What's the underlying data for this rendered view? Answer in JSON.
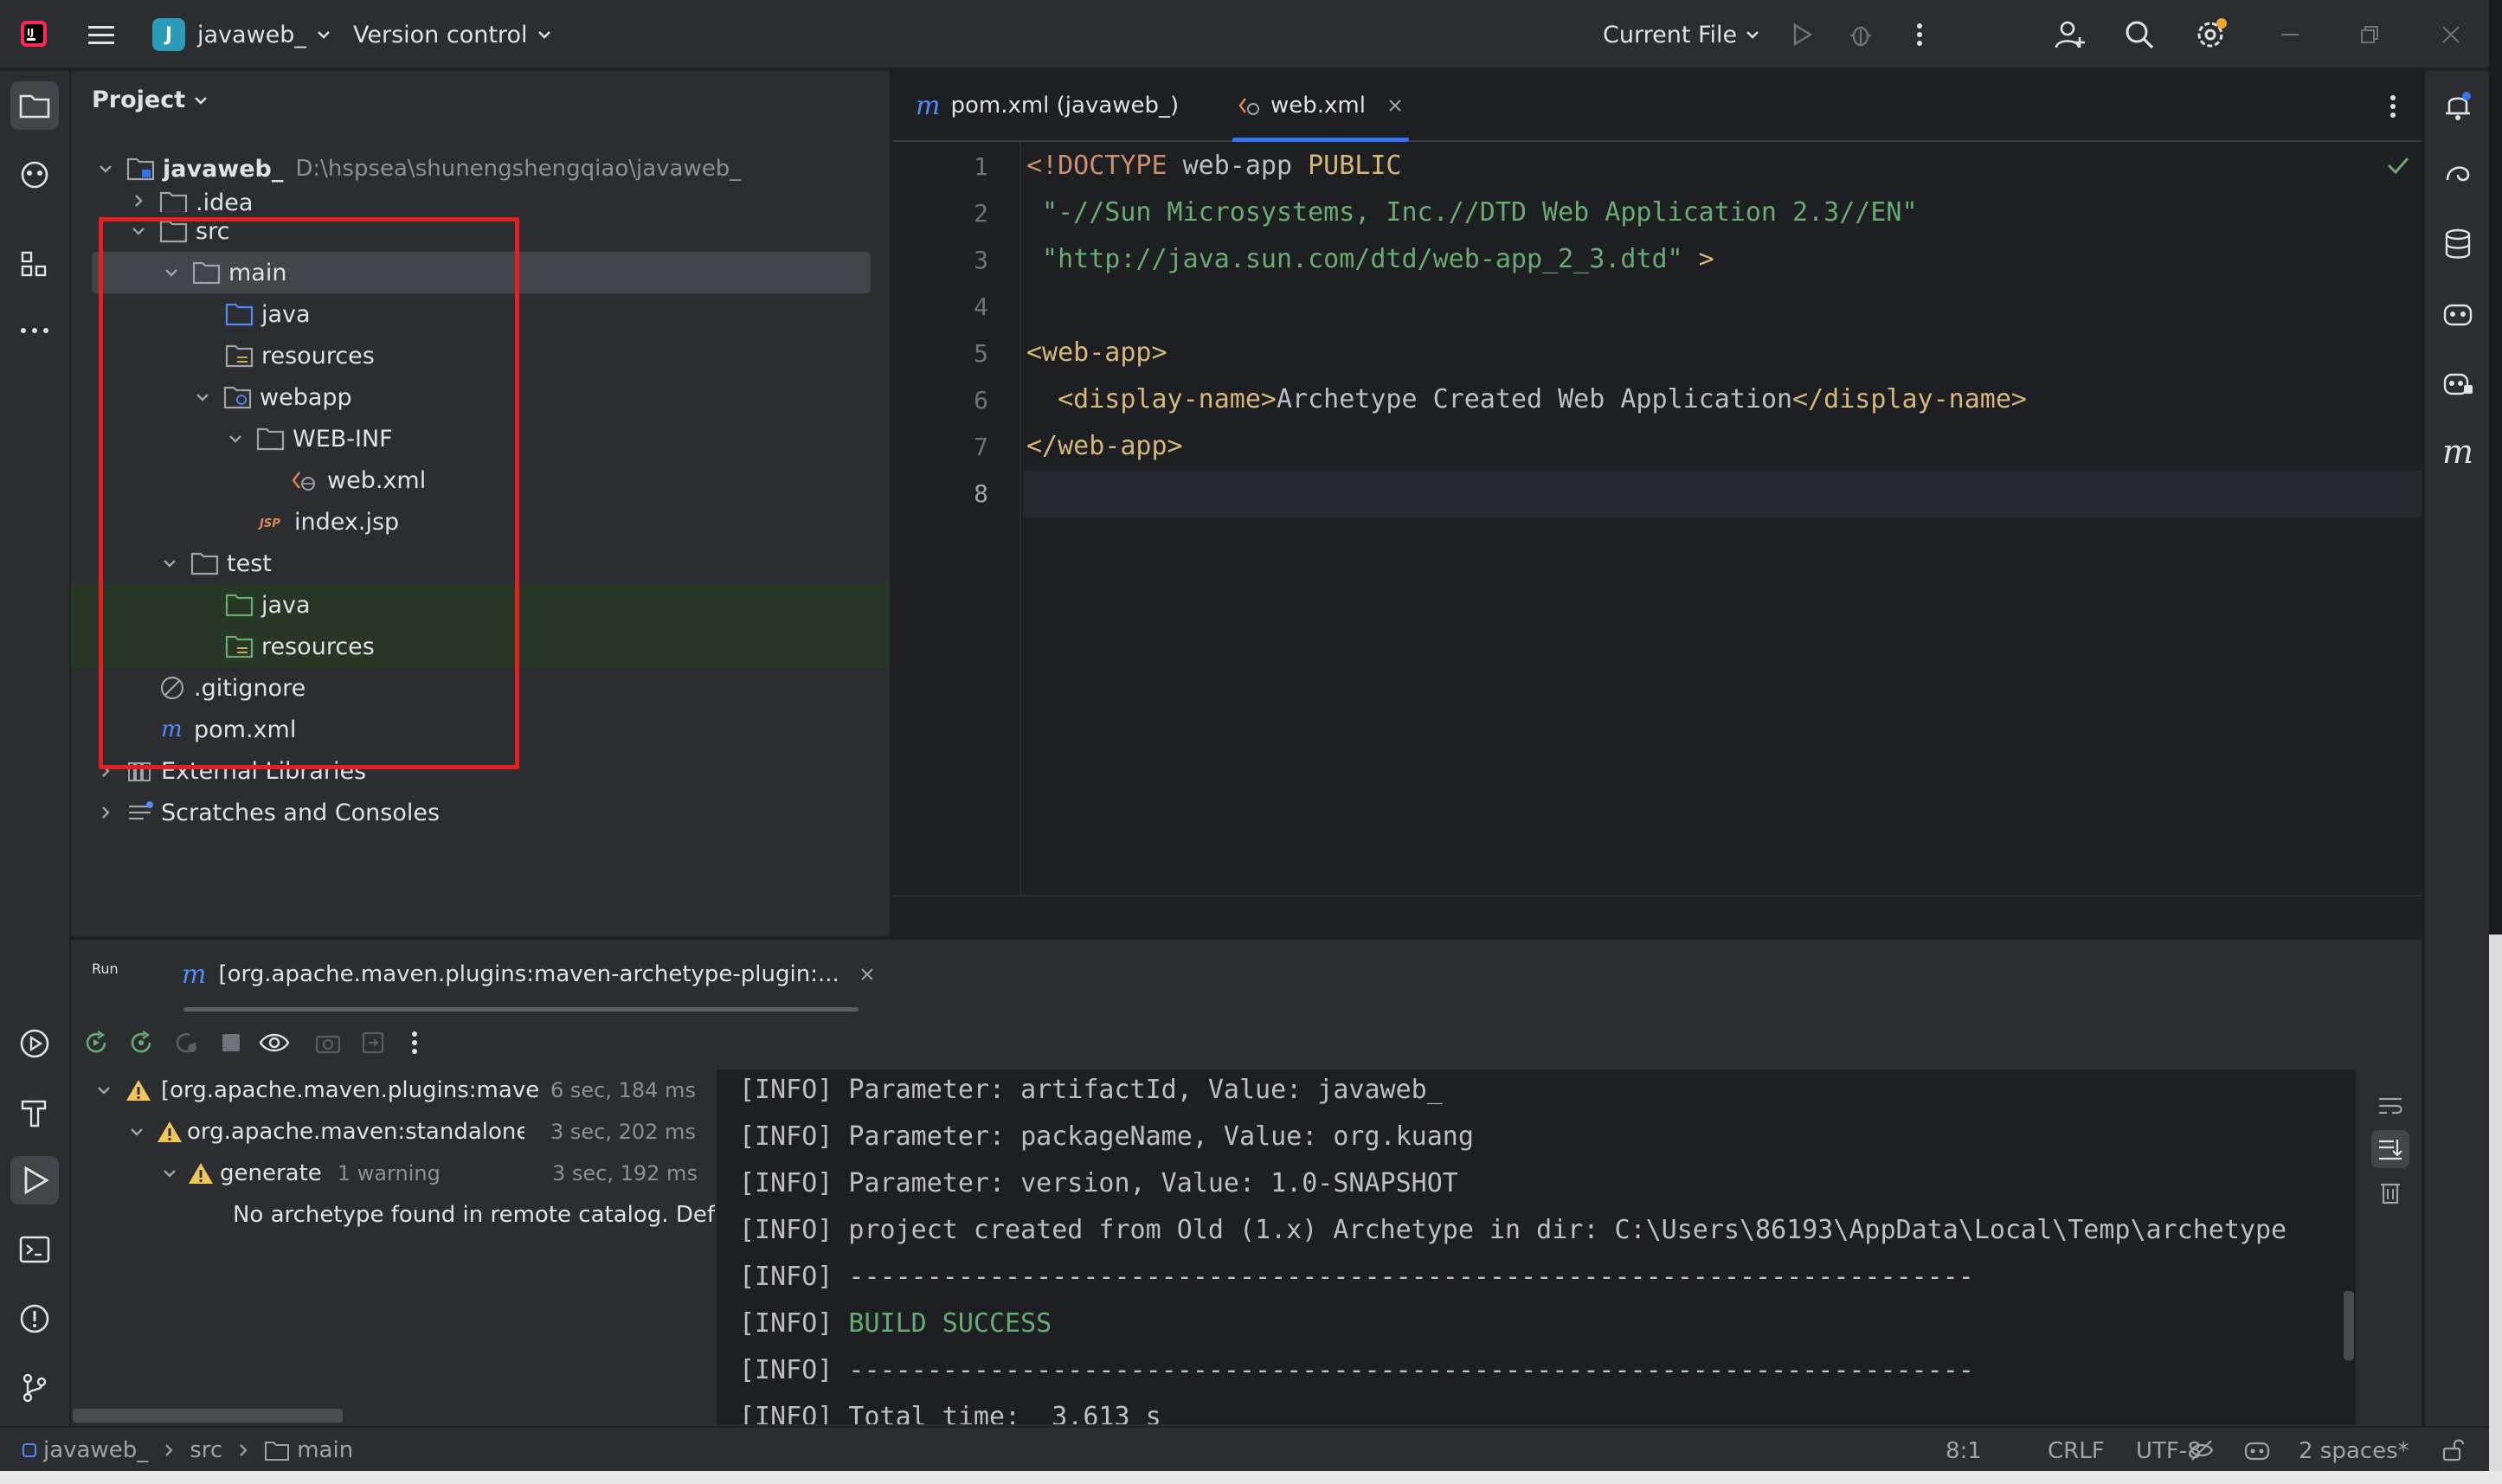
{
  "titlebar": {
    "project_badge": "J",
    "project_name": "javaweb_",
    "vcs": "Version control",
    "run_config": "Current File"
  },
  "project_panel": {
    "title": "Project",
    "tree": [
      {
        "label": "javaweb_",
        "hint": "D:\\hspsea\\shunengshengqiao\\javaweb_"
      },
      {
        "label": ".idea"
      },
      {
        "label": "src"
      },
      {
        "label": "main"
      },
      {
        "label": "java"
      },
      {
        "label": "resources"
      },
      {
        "label": "webapp"
      },
      {
        "label": "WEB-INF"
      },
      {
        "label": "web.xml"
      },
      {
        "label": "index.jsp"
      },
      {
        "label": "test"
      },
      {
        "label": "java"
      },
      {
        "label": "resources"
      },
      {
        "label": ".gitignore"
      },
      {
        "label": "pom.xml"
      },
      {
        "label": "External Libraries"
      },
      {
        "label": "Scratches and Consoles"
      }
    ]
  },
  "editor": {
    "tabs": [
      {
        "label": "pom.xml (javaweb_)"
      },
      {
        "label": "web.xml"
      }
    ],
    "line_numbers": [
      "1",
      "2",
      "3",
      "4",
      "5",
      "6",
      "7",
      "8"
    ],
    "lines": {
      "l1a": "<!DOCTYPE",
      "l1b": " web-app ",
      "l1c": "PUBLIC",
      "l2": " \"-//Sun Microsystems, Inc.//DTD Web Application 2.3//EN\"",
      "l3a": " \"http://java.sun.com/dtd/web-app_2_3.dtd\"",
      "l3b": " >",
      "l5": "<web-app>",
      "l6a": "  <display-name>",
      "l6b": "Archetype Created Web Application",
      "l6c": "</display-name>",
      "l7": "</web-app>"
    }
  },
  "run_panel": {
    "title": "Run",
    "tab_label": "[org.apache.maven.plugins:maven-archetype-plugin:...",
    "tree": [
      {
        "label": "[org.apache.maven.plugins:mave",
        "time": "6 sec, 184 ms"
      },
      {
        "label": "org.apache.maven:standalone-pc",
        "time": "3 sec, 202 ms"
      },
      {
        "label": "generate",
        "extra": "1 warning",
        "time": "3 sec, 192 ms"
      },
      {
        "label": "No archetype found in remote catalog. Def"
      }
    ],
    "console": [
      {
        "tag": "[INFO]",
        "text": " Parameter: artifactId, Value: javaweb_"
      },
      {
        "tag": "[INFO]",
        "text": " Parameter: packageName, Value: org.kuang"
      },
      {
        "tag": "[INFO]",
        "text": " Parameter: version, Value: 1.0-SNAPSHOT"
      },
      {
        "tag": "[INFO]",
        "text": " project created from Old (1.x) Archetype in dir: C:\\Users\\86193\\AppData\\Local\\Temp\\archetype"
      },
      {
        "tag": "[INFO]",
        "text": " ------------------------------------------------------------------------"
      },
      {
        "tag": "[INFO]",
        "text": " BUILD SUCCESS"
      },
      {
        "tag": "[INFO]",
        "text": " ------------------------------------------------------------------------"
      },
      {
        "tag": "[INFO]",
        "text": " Total time:  3.613 s"
      }
    ]
  },
  "statusbar": {
    "breadcrumb": [
      "javaweb_",
      "src",
      "main"
    ],
    "position": "8:1",
    "line_sep": "CRLF",
    "encoding": "UTF-8",
    "indent": "2 spaces*"
  },
  "colors": {
    "accent": "#3574f0",
    "highlight_box": "#e1211f",
    "success": "#6aab73",
    "warning": "#f2c55c"
  }
}
